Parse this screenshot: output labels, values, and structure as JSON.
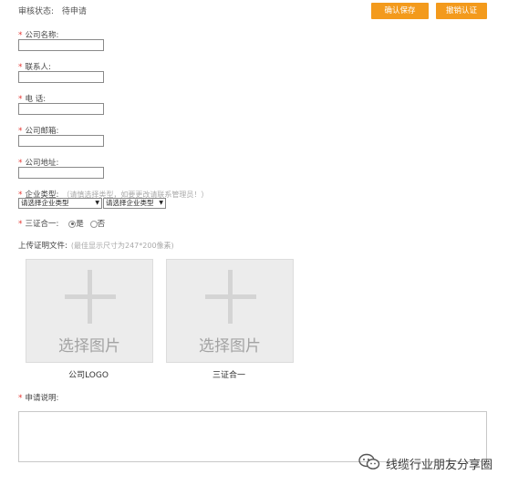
{
  "header": {
    "status_label": "审核状态:",
    "status_value": "待申请",
    "confirm_save": "确认保存",
    "cancel_auth": "撤销认证"
  },
  "form": {
    "company_name": {
      "required": "*",
      "label": "公司名称:"
    },
    "contact": {
      "required": "*",
      "label": "联系人:"
    },
    "phone": {
      "required": "*",
      "label": "电 话:"
    },
    "email": {
      "required": "*",
      "label": "公司邮箱:"
    },
    "address": {
      "required": "*",
      "label": "公司地址:"
    },
    "enterprise_type": {
      "required": "*",
      "label": "企业类型:",
      "hint": "（请慎选择类型，如要更改请联系管理员！）",
      "select1": "请选择企业类型",
      "select2": "请选择企业类型"
    },
    "three_in_one": {
      "required": "*",
      "label": "三证合一:",
      "yes": "是",
      "no": "否",
      "selected": "是"
    },
    "upload": {
      "label": "上传证明文件:",
      "hint": "(最佳显示尺寸为247*200像素)",
      "box_text": "选择图片",
      "caption_logo": "公司LOGO",
      "caption_cert": "三证合一"
    },
    "description": {
      "required": "*",
      "label": "申请说明:"
    }
  },
  "watermark": {
    "text": "线缆行业朋友分享圈",
    "icon": "wechat-icon"
  },
  "colors": {
    "accent": "#f39a1c",
    "required": "#e53935"
  }
}
